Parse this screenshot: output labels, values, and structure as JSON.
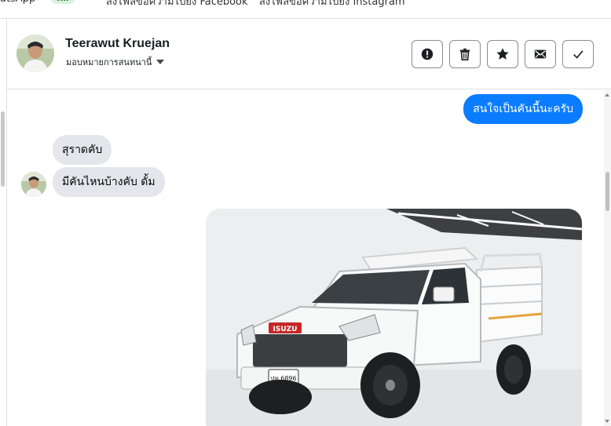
{
  "tabstrip": {
    "items": [
      "atsApp",
      "fill",
      "ส่งไฟล์ข้อความไปยัง Facebook",
      "ส่งไฟล์ข้อความไปยัง Instagram"
    ]
  },
  "header": {
    "name": "Teerawut Kruejan",
    "assign_label": "มอบหมายการสนทนานี้"
  },
  "actions": [
    {
      "icon": "alert-icon"
    },
    {
      "icon": "trash-icon"
    },
    {
      "icon": "star-icon"
    },
    {
      "icon": "mail-icon"
    },
    {
      "icon": "check-icon"
    }
  ],
  "messages": [
    {
      "direction": "out",
      "text": "สนใจเป็นคันนี้นะครับ"
    },
    {
      "direction": "in",
      "text": "สุราดคับ"
    },
    {
      "direction": "in",
      "text": "มีคันไหนบ้างคับ ดั้ม"
    }
  ],
  "image": {
    "plate": "ปท 6896",
    "brand": "ISUZU"
  },
  "colors": {
    "outgoing": "#0a7cff",
    "incoming": "#e4e6eb"
  }
}
